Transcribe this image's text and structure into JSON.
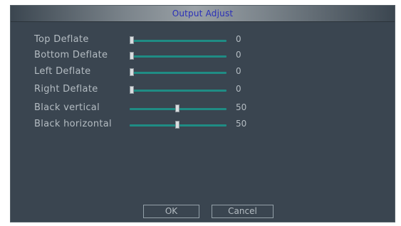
{
  "dialog": {
    "title": "Output Adjust"
  },
  "rows": [
    {
      "label": "Top Deflate",
      "value": 0,
      "value_text": "0",
      "min": 0,
      "max": 100
    },
    {
      "label": "Bottom Deflate",
      "value": 0,
      "value_text": "0",
      "min": 0,
      "max": 100
    },
    {
      "label": "Left Deflate",
      "value": 0,
      "value_text": "0",
      "min": 0,
      "max": 100
    },
    {
      "label": "Right Deflate",
      "value": 0,
      "value_text": "0",
      "min": 0,
      "max": 100
    },
    {
      "label": "Black vertical",
      "value": 50,
      "value_text": "50",
      "min": 0,
      "max": 100
    },
    {
      "label": "Black horizontal",
      "value": 50,
      "value_text": "50",
      "min": 0,
      "max": 100
    }
  ],
  "buttons": {
    "ok_label": "OK",
    "cancel_label": "Cancel"
  },
  "colors": {
    "background": "#3a4550",
    "title_text": "#2a2fb8",
    "label_text": "#b4bcc2",
    "slider_track": "#1f8c84"
  }
}
